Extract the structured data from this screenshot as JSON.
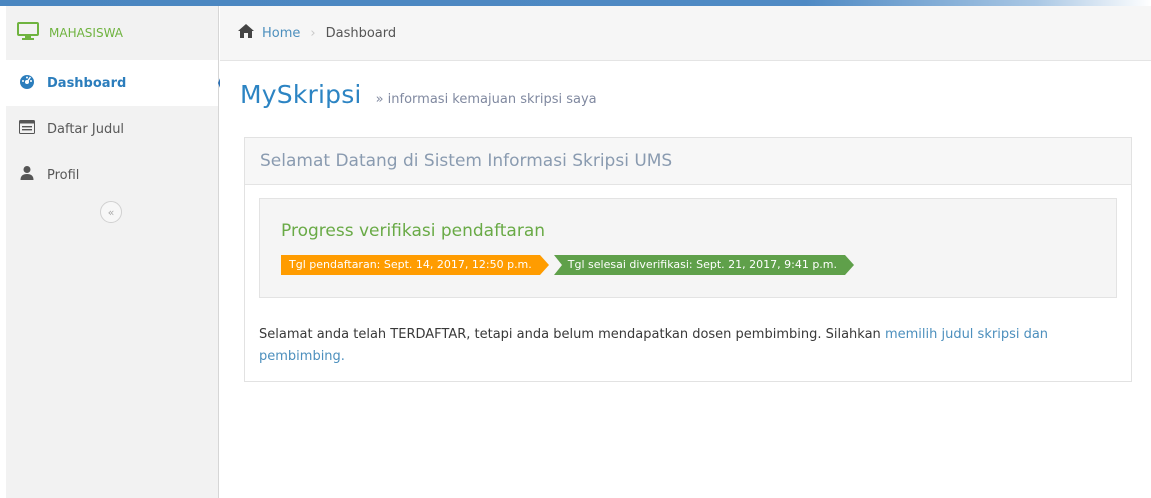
{
  "sidebar": {
    "brand_label": "MAHASISWA",
    "items": [
      {
        "label": "Dashboard",
        "icon": "dashboard-icon",
        "active": true
      },
      {
        "label": "Daftar Judul",
        "icon": "list-icon",
        "active": false
      },
      {
        "label": "Profil",
        "icon": "user-icon",
        "active": false
      }
    ],
    "collapse_icon": "«"
  },
  "breadcrumb": {
    "home_label": "Home",
    "current_label": "Dashboard"
  },
  "page_header": {
    "title": "MySkripsi",
    "subtitle": "» informasi kemajuan skripsi saya"
  },
  "panel": {
    "title": "Selamat Datang di Sistem Informasi Skripsi UMS",
    "progress_title": "Progress verifikasi pendaftaran",
    "tag_registration": "Tgl pendaftaran: Sept. 14, 2017, 12:50 p.m.",
    "tag_verified": "Tgl selesai diverifikasi: Sept. 21, 2017, 9:41 p.m.",
    "message_text": "Selamat anda telah TERDAFTAR, tetapi anda belum mendapatkan dosen pembimbing. Silahkan ",
    "message_link": "memilih judul skripsi dan pembimbing."
  },
  "colors": {
    "accent_blue": "#2c84c3",
    "brand_green": "#6fb33f",
    "tag_orange": "#ff9c00",
    "tag_green": "#5fa04a"
  }
}
